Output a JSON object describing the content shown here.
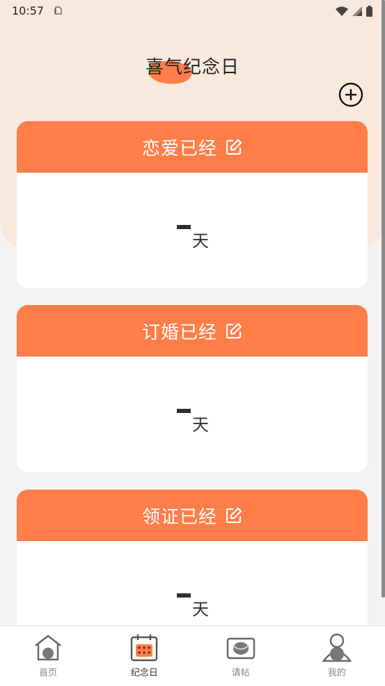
{
  "status_bar": {
    "time": "10:57"
  },
  "header": {
    "title": "喜气纪念日"
  },
  "cards": [
    {
      "title": "恋爱已经",
      "unit": "天"
    },
    {
      "title": "订婚已经",
      "unit": "天"
    },
    {
      "title": "领证已经",
      "unit": "天"
    }
  ],
  "nav": {
    "items": [
      {
        "label": "首页",
        "icon": "home-icon"
      },
      {
        "label": "纪念日",
        "icon": "calendar-icon",
        "active": true
      },
      {
        "label": "请帖",
        "icon": "invitation-icon"
      },
      {
        "label": "我的",
        "icon": "profile-icon"
      }
    ]
  },
  "colors": {
    "accent": "#ff7d48",
    "header_bg": "#f8e8dd",
    "page_bg": "#f3f3f3"
  }
}
